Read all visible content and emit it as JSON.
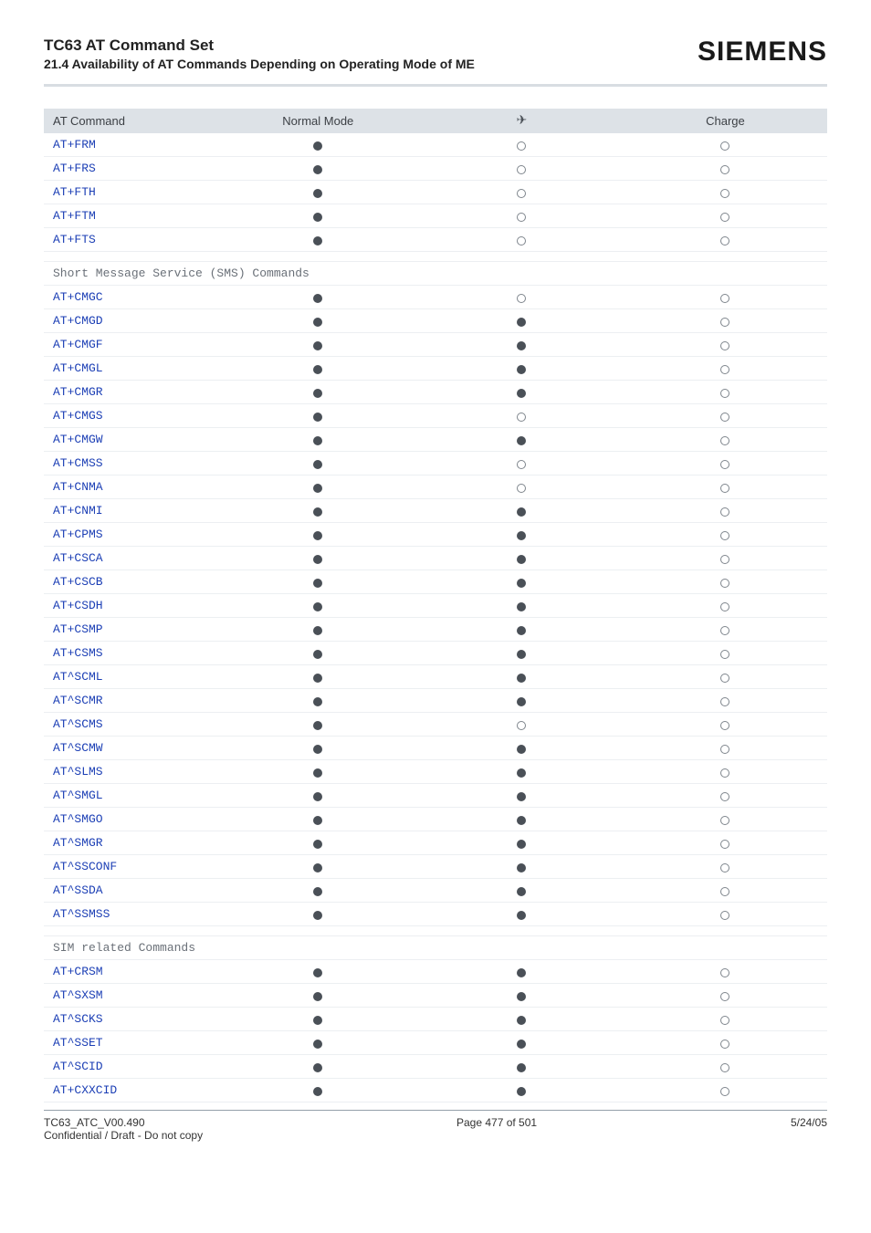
{
  "header": {
    "title": "TC63 AT Command Set",
    "subtitle": "21.4 Availability of AT Commands Depending on Operating Mode of ME",
    "logo": "SIEMENS"
  },
  "table": {
    "headers": {
      "col1": "AT Command",
      "col2": "Normal Mode",
      "col3_icon": "airplane-icon",
      "col4": "Charge"
    },
    "section_fax": [
      {
        "cmd": "AT+FRM",
        "normal": "solid",
        "air": "open",
        "charge": "open"
      },
      {
        "cmd": "AT+FRS",
        "normal": "solid",
        "air": "open",
        "charge": "open"
      },
      {
        "cmd": "AT+FTH",
        "normal": "solid",
        "air": "open",
        "charge": "open"
      },
      {
        "cmd": "AT+FTM",
        "normal": "solid",
        "air": "open",
        "charge": "open"
      },
      {
        "cmd": "AT+FTS",
        "normal": "solid",
        "air": "open",
        "charge": "open"
      }
    ],
    "section_sms_title": "Short Message Service (SMS) Commands",
    "section_sms": [
      {
        "cmd": "AT+CMGC",
        "normal": "solid",
        "air": "open",
        "charge": "open"
      },
      {
        "cmd": "AT+CMGD",
        "normal": "solid",
        "air": "solid",
        "charge": "open"
      },
      {
        "cmd": "AT+CMGF",
        "normal": "solid",
        "air": "solid",
        "charge": "open"
      },
      {
        "cmd": "AT+CMGL",
        "normal": "solid",
        "air": "solid",
        "charge": "open"
      },
      {
        "cmd": "AT+CMGR",
        "normal": "solid",
        "air": "solid",
        "charge": "open"
      },
      {
        "cmd": "AT+CMGS",
        "normal": "solid",
        "air": "open",
        "charge": "open"
      },
      {
        "cmd": "AT+CMGW",
        "normal": "solid",
        "air": "solid",
        "charge": "open"
      },
      {
        "cmd": "AT+CMSS",
        "normal": "solid",
        "air": "open",
        "charge": "open"
      },
      {
        "cmd": "AT+CNMA",
        "normal": "solid",
        "air": "open",
        "charge": "open"
      },
      {
        "cmd": "AT+CNMI",
        "normal": "solid",
        "air": "solid",
        "charge": "open"
      },
      {
        "cmd": "AT+CPMS",
        "normal": "solid",
        "air": "solid",
        "charge": "open"
      },
      {
        "cmd": "AT+CSCA",
        "normal": "solid",
        "air": "solid",
        "charge": "open"
      },
      {
        "cmd": "AT+CSCB",
        "normal": "solid",
        "air": "solid",
        "charge": "open"
      },
      {
        "cmd": "AT+CSDH",
        "normal": "solid",
        "air": "solid",
        "charge": "open"
      },
      {
        "cmd": "AT+CSMP",
        "normal": "solid",
        "air": "solid",
        "charge": "open"
      },
      {
        "cmd": "AT+CSMS",
        "normal": "solid",
        "air": "solid",
        "charge": "open"
      },
      {
        "cmd": "AT^SCML",
        "normal": "solid",
        "air": "solid",
        "charge": "open"
      },
      {
        "cmd": "AT^SCMR",
        "normal": "solid",
        "air": "solid",
        "charge": "open"
      },
      {
        "cmd": "AT^SCMS",
        "normal": "solid",
        "air": "open",
        "charge": "open"
      },
      {
        "cmd": "AT^SCMW",
        "normal": "solid",
        "air": "solid",
        "charge": "open"
      },
      {
        "cmd": "AT^SLMS",
        "normal": "solid",
        "air": "solid",
        "charge": "open"
      },
      {
        "cmd": "AT^SMGL",
        "normal": "solid",
        "air": "solid",
        "charge": "open"
      },
      {
        "cmd": "AT^SMGO",
        "normal": "solid",
        "air": "solid",
        "charge": "open"
      },
      {
        "cmd": "AT^SMGR",
        "normal": "solid",
        "air": "solid",
        "charge": "open"
      },
      {
        "cmd": "AT^SSCONF",
        "normal": "solid",
        "air": "solid",
        "charge": "open"
      },
      {
        "cmd": "AT^SSDA",
        "normal": "solid",
        "air": "solid",
        "charge": "open"
      },
      {
        "cmd": "AT^SSMSS",
        "normal": "solid",
        "air": "solid",
        "charge": "open"
      }
    ],
    "section_sim_title": "SIM related Commands",
    "section_sim": [
      {
        "cmd": "AT+CRSM",
        "normal": "solid",
        "air": "solid",
        "charge": "open"
      },
      {
        "cmd": "AT^SXSM",
        "normal": "solid",
        "air": "solid",
        "charge": "open"
      },
      {
        "cmd": "AT^SCKS",
        "normal": "solid",
        "air": "solid",
        "charge": "open"
      },
      {
        "cmd": "AT^SSET",
        "normal": "solid",
        "air": "solid",
        "charge": "open"
      },
      {
        "cmd": "AT^SCID",
        "normal": "solid",
        "air": "solid",
        "charge": "open"
      },
      {
        "cmd": "AT+CXXCID",
        "normal": "solid",
        "air": "solid",
        "charge": "open"
      }
    ]
  },
  "footer": {
    "left_line1": "TC63_ATC_V00.490",
    "left_line2": "Confidential / Draft - Do not copy",
    "center": "Page 477 of 501",
    "right": "5/24/05"
  }
}
